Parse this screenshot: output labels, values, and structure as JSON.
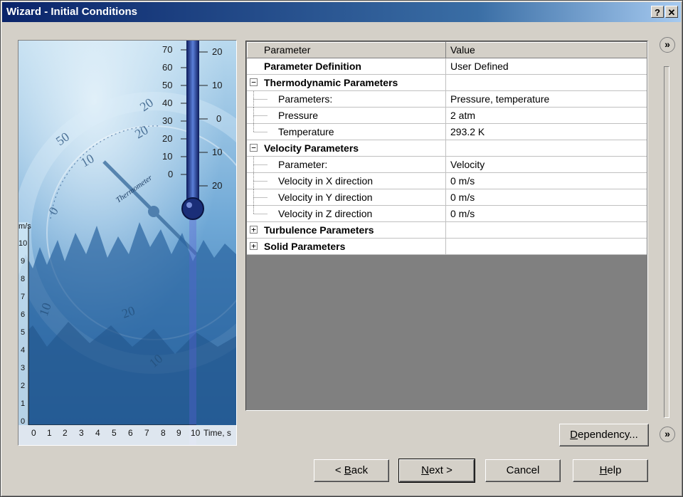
{
  "window": {
    "title": "Wizard - Initial Conditions",
    "help_glyph": "?",
    "close_glyph": "✕"
  },
  "illustration": {
    "thermo_left_ticks": [
      "70",
      "60",
      "50",
      "40",
      "30",
      "20",
      "10",
      "0"
    ],
    "thermo_right_ticks": [
      "20",
      "10",
      "0",
      "10",
      "20"
    ],
    "gauge_numbers": [
      "50",
      "20",
      "10",
      "20",
      "0",
      "10",
      "20",
      "10"
    ],
    "gauge_label": "Thermometer",
    "y_axis_unit": "m/s",
    "y_axis_ticks": [
      "10",
      "9",
      "8",
      "7",
      "6",
      "5",
      "4",
      "3",
      "2",
      "1",
      "0"
    ],
    "x_axis_ticks": [
      "0",
      "1",
      "2",
      "3",
      "4",
      "5",
      "6",
      "7",
      "8",
      "9",
      "10"
    ],
    "x_axis_label": "Time, s"
  },
  "grid": {
    "header": {
      "param": "Parameter",
      "value": "Value"
    },
    "rows": [
      {
        "label": "Parameter Definition",
        "value": "User Defined"
      },
      {
        "label": "Thermodynamic Parameters",
        "value": "",
        "expander": "−"
      },
      {
        "label": "Parameters:",
        "value": "Pressure, temperature"
      },
      {
        "label": "Pressure",
        "value": "2 atm"
      },
      {
        "label": "Temperature",
        "value": "293.2 K"
      },
      {
        "label": "Velocity Parameters",
        "value": "",
        "expander": "−"
      },
      {
        "label": "Parameter:",
        "value": "Velocity"
      },
      {
        "label": "Velocity in X direction",
        "value": "0 m/s"
      },
      {
        "label": "Velocity in Y direction",
        "value": "0 m/s"
      },
      {
        "label": "Velocity in Z direction",
        "value": "0 m/s"
      },
      {
        "label": "Turbulence Parameters",
        "value": "",
        "expander": "+"
      },
      {
        "label": "Solid Parameters",
        "value": "",
        "expander": "+"
      }
    ]
  },
  "side": {
    "top_arrow": "»",
    "bottom_arrow": "»"
  },
  "buttons": {
    "dependency_mnemonic": "D",
    "dependency_rest": "ependency...",
    "back_prefix": "< ",
    "back_mnemonic": "B",
    "back_rest": "ack",
    "next_mnemonic": "N",
    "next_rest": "ext >",
    "cancel": "Cancel",
    "help_mnemonic": "H",
    "help_rest": "elp"
  },
  "colors": {
    "title_start": "#0a246a",
    "face": "#d4d0c8",
    "grid_empty": "#808080",
    "illustration_blue": "#2f6fb0"
  }
}
